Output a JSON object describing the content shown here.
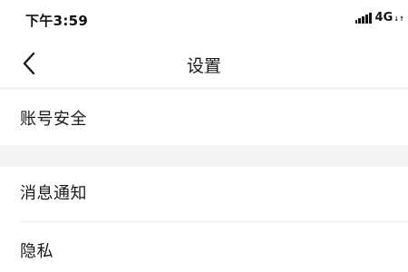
{
  "status_bar": {
    "time": "下午3:59",
    "network": "4G",
    "network_arrows": "↓↑",
    "signal_icon": "signal-bars-icon"
  },
  "nav": {
    "title": "设置",
    "back_icon": "chevron-left-icon"
  },
  "settings": {
    "items": [
      {
        "label": "账号安全"
      },
      {
        "label": "消息通知"
      },
      {
        "label": "隐私"
      }
    ]
  },
  "colors": {
    "background": "#ffffff",
    "group_gap": "#f4f4f4",
    "separator": "#ececec",
    "text": "#1a1a1a"
  }
}
